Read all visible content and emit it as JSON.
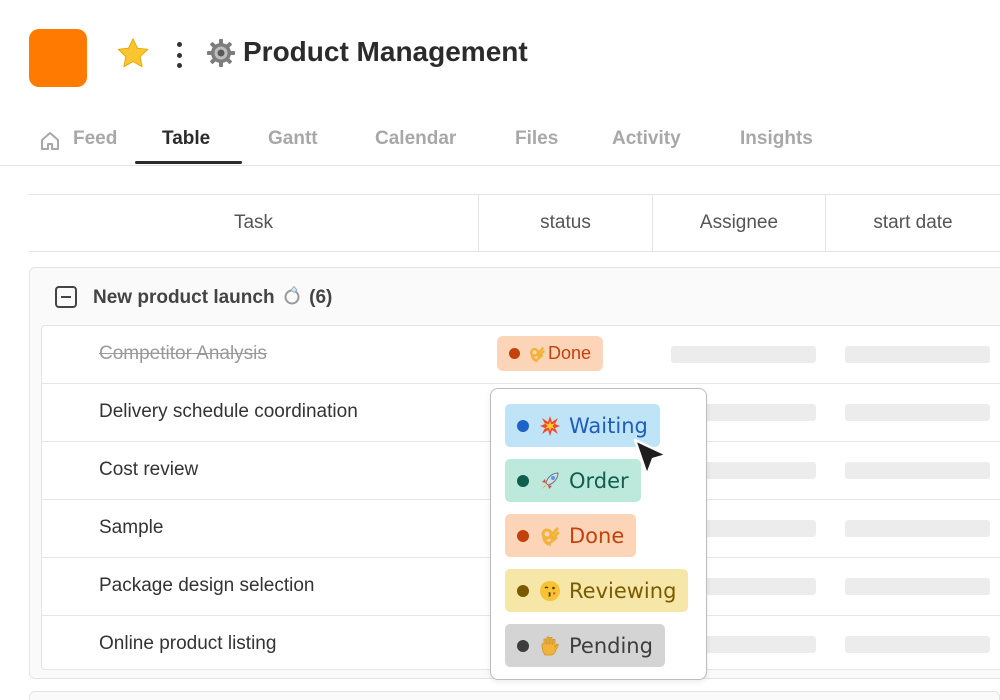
{
  "header": {
    "title": "Product Management"
  },
  "tabs": [
    {
      "label": "Feed"
    },
    {
      "label": "Table"
    },
    {
      "label": "Gantt"
    },
    {
      "label": "Calendar"
    },
    {
      "label": "Files"
    },
    {
      "label": "Activity"
    },
    {
      "label": "Insights"
    }
  ],
  "table": {
    "columns": [
      "Task",
      "status",
      "Assignee",
      "start date"
    ]
  },
  "group": {
    "name": "New product launch",
    "count": "(6)",
    "rows": [
      {
        "task": "Competitor Analysis",
        "status": "Done"
      },
      {
        "task": "Delivery schedule coordination"
      },
      {
        "task": "Cost review"
      },
      {
        "task": "Sample"
      },
      {
        "task": "Package design selection"
      },
      {
        "task": "Online product listing"
      }
    ]
  },
  "status_options": [
    {
      "label": "Waiting",
      "bg": "#bfe3f7",
      "dot": "#1d63c8",
      "text": "#1d5fb8",
      "icon": "collision-icon"
    },
    {
      "label": "Order",
      "bg": "#bde9dc",
      "dot": "#0f5e4e",
      "text": "#0f5e4e",
      "icon": "rocket-icon"
    },
    {
      "label": "Done",
      "bg": "#fcd5b8",
      "dot": "#c2410c",
      "text": "#c2410c",
      "icon": "ok-hand-icon"
    },
    {
      "label": "Reviewing",
      "bg": "#f6e7a8",
      "dot": "#7a5a00",
      "text": "#7a5a00",
      "icon": "kiss-face-icon"
    },
    {
      "label": "Pending",
      "bg": "#d4d4d4",
      "dot": "#3d3d3d",
      "text": "#3d3d3d",
      "icon": "raised-hand-icon"
    }
  ],
  "colors": {
    "app_icon": "#ff7a00",
    "active_tab": "#2b2b2b",
    "inactive_tab": "#a8a8a8"
  }
}
